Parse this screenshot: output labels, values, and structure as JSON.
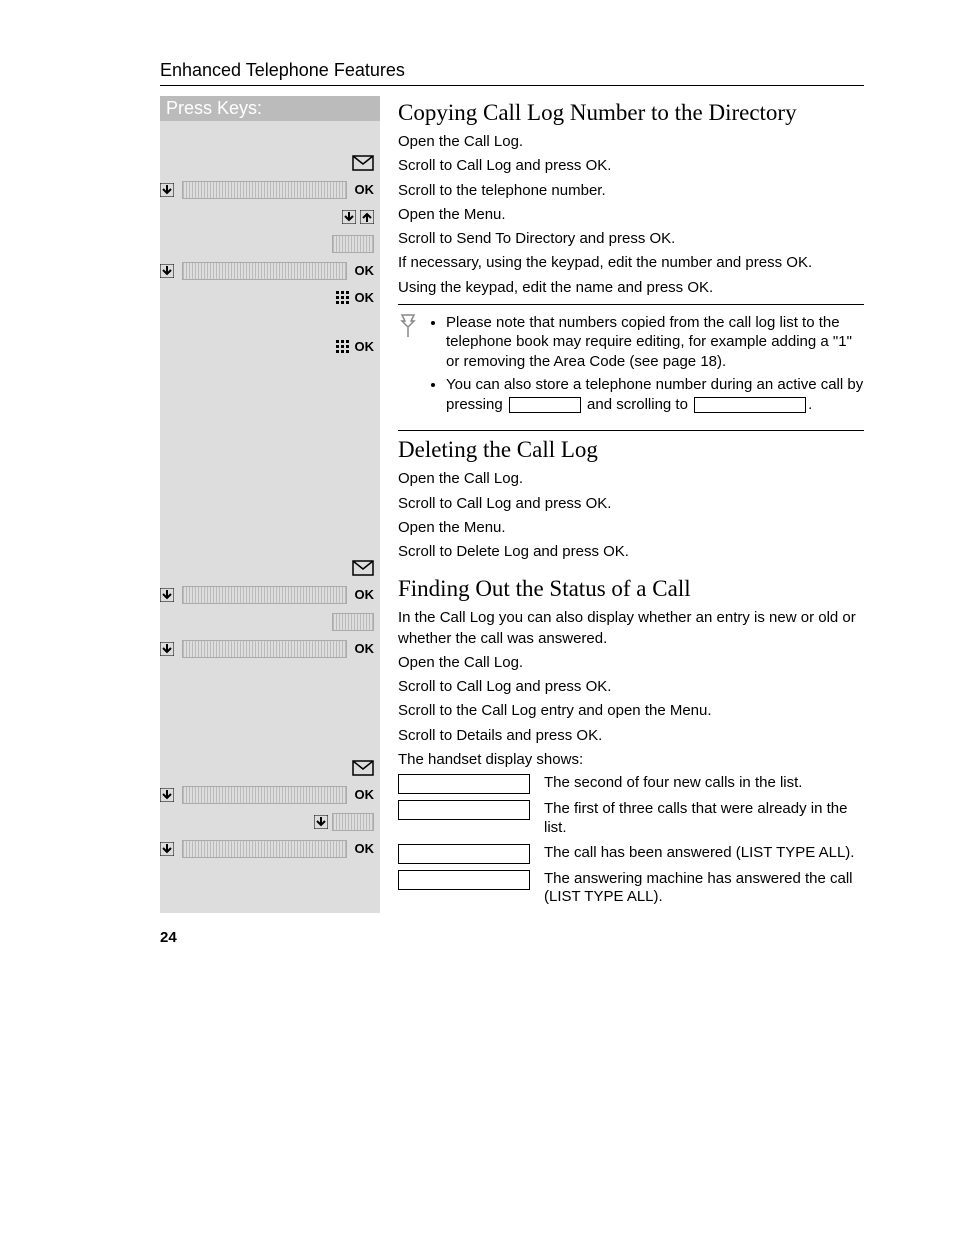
{
  "header": {
    "title": "Enhanced Telephone Features"
  },
  "press": {
    "title": "Press Keys:",
    "ok": "OK"
  },
  "section1": {
    "title": "Copying Call Log Number to the Directory",
    "steps": [
      "Open the Call Log.",
      "Scroll to Call Log and press OK.",
      "Scroll to the telephone number.",
      "Open the Menu.",
      "Scroll to Send To Directory and press OK.",
      "If necessary, using the keypad, edit the number and press OK.",
      "Using the keypad, edit the name and press OK."
    ],
    "notes": {
      "n1": "Please note that numbers copied from the call log list to the telephone book may require editing, for example adding a \"1\" or removing the Area Code (see page 18).",
      "n2a": "You can also store a telephone number during an active call by pressing ",
      "n2b": " and scrolling to "
    }
  },
  "section2": {
    "title": "Deleting the Call Log",
    "steps": [
      "Open the Call Log.",
      "Scroll to Call Log and press OK.",
      "Open the Menu.",
      "Scroll to Delete Log and press OK."
    ]
  },
  "section3": {
    "title": "Finding Out the Status of a Call",
    "intro": "In the Call Log you can also display whether an entry is new or old or whether the call was answered.",
    "steps": [
      "Open the Call Log.",
      "Scroll to Call Log and press OK.",
      "Scroll to the Call Log entry and open the Menu.",
      "Scroll to Details and press OK.",
      "The handset display shows:"
    ],
    "status": [
      "The second of four new calls in the list.",
      "The first of three calls that were already in the list.",
      "The call has been answered (LIST TYPE ALL).",
      "The answering machine has answered the call (LIST TYPE ALL)."
    ]
  },
  "pagenum": "24"
}
